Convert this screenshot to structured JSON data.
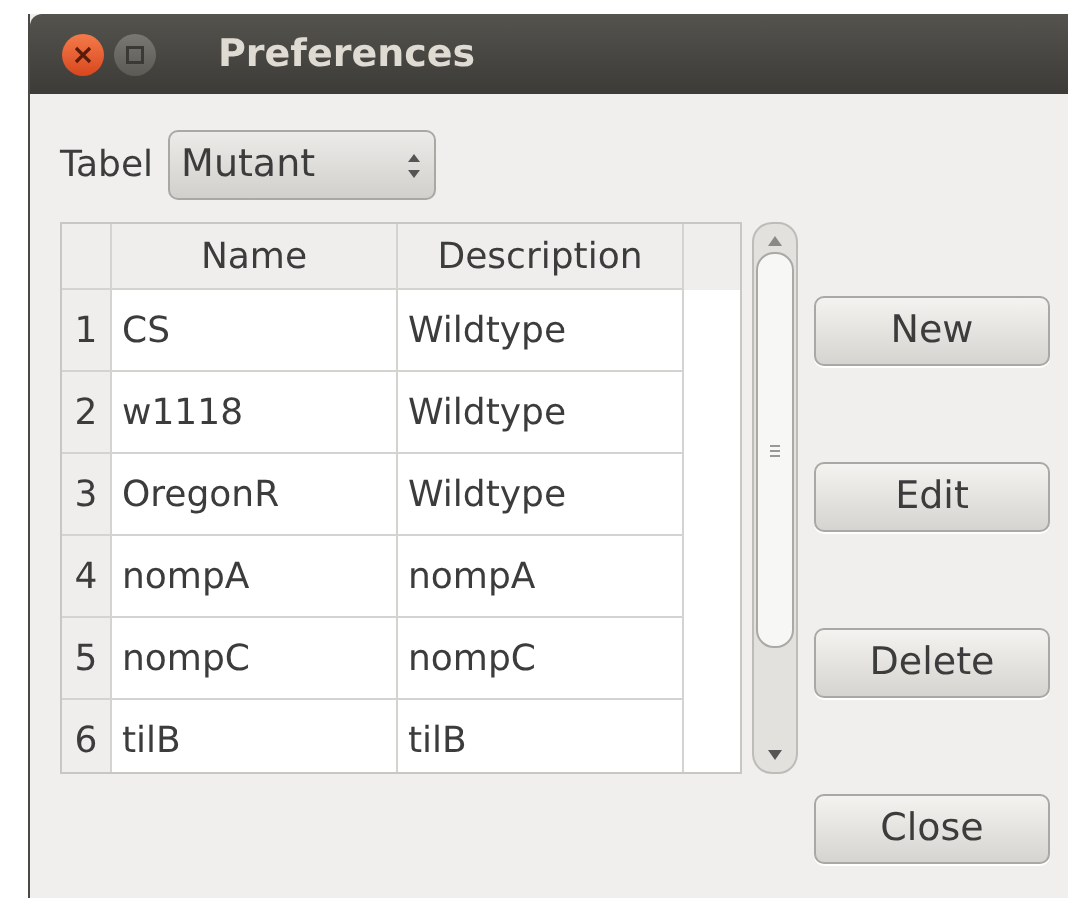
{
  "window": {
    "title": "Preferences"
  },
  "table_selector": {
    "label": "Tabel",
    "value": "Mutant"
  },
  "table": {
    "columns": [
      "Name",
      "Description"
    ],
    "rows": [
      {
        "number": "1",
        "name": "CS",
        "description": "Wildtype"
      },
      {
        "number": "2",
        "name": "w1118",
        "description": "Wildtype"
      },
      {
        "number": "3",
        "name": "OregonR",
        "description": "Wildtype"
      },
      {
        "number": "4",
        "name": "nompA",
        "description": "nompA"
      },
      {
        "number": "5",
        "name": "nompC",
        "description": "nompC"
      },
      {
        "number": "6",
        "name": "tilB",
        "description": "tilB"
      }
    ]
  },
  "buttons": [
    "New",
    "Edit",
    "Delete"
  ],
  "close_button": "Close"
}
